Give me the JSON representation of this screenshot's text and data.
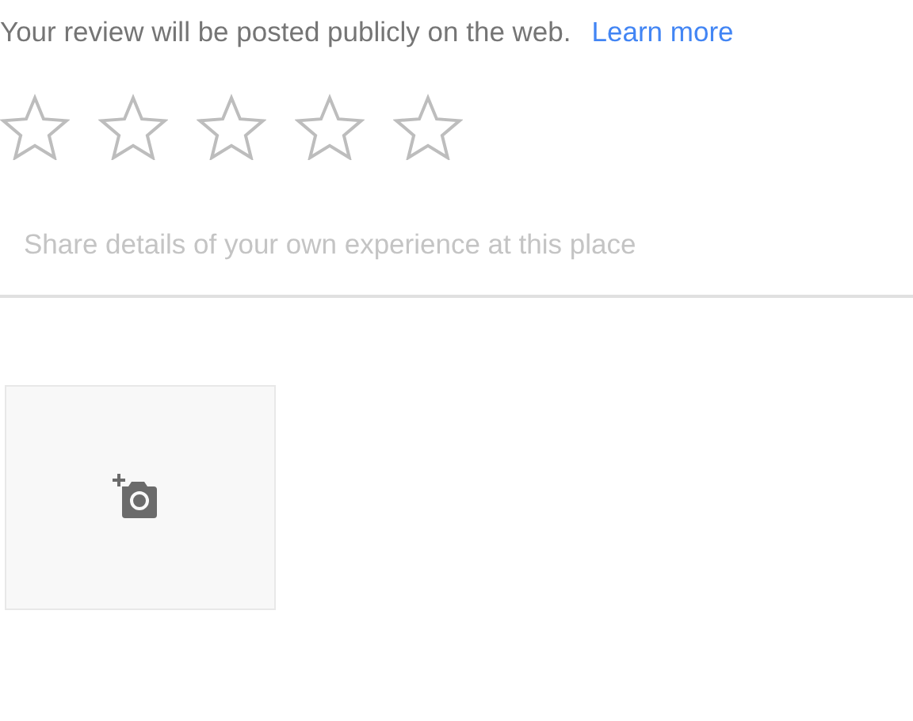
{
  "notice": {
    "text": "Your review will be posted publicly on the web.",
    "link": "Learn more"
  },
  "rating": {
    "stars": 0
  },
  "review_field": {
    "placeholder": "Share details of your own experience at this place"
  }
}
